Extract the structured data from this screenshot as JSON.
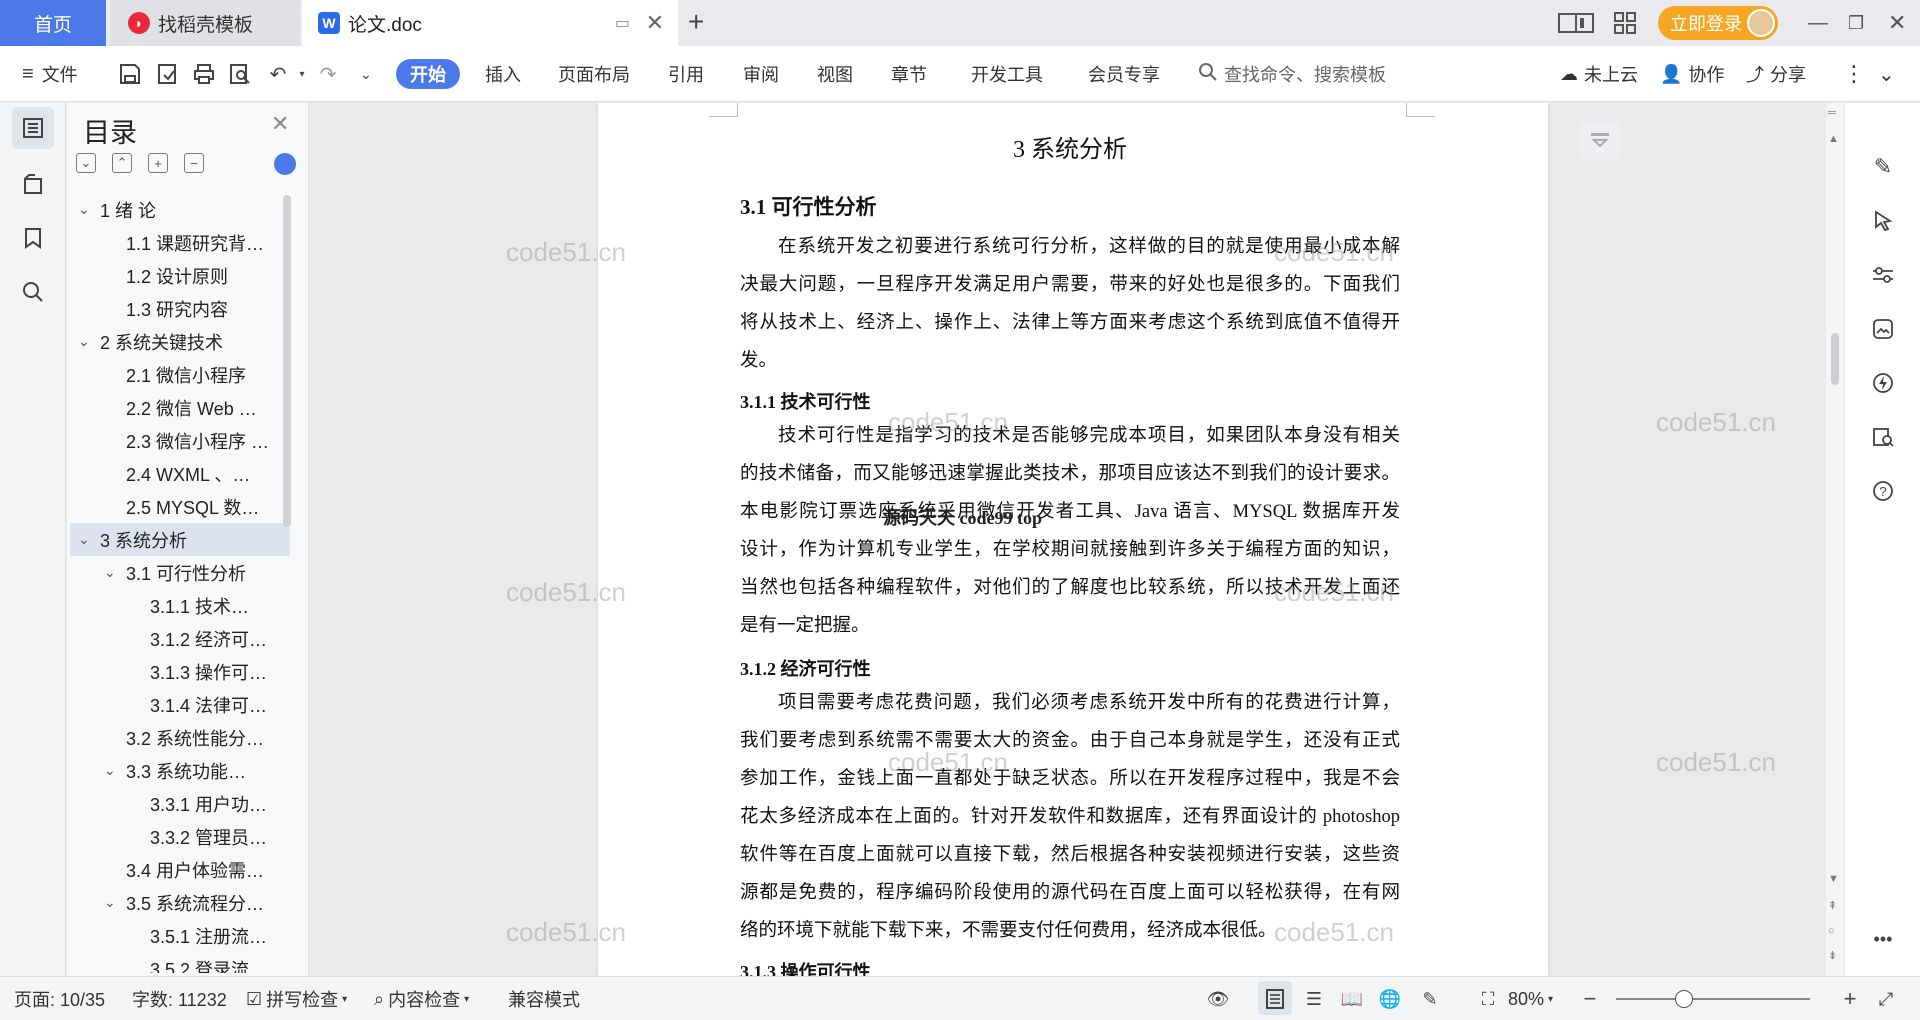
{
  "titlebar": {
    "home_tab": "首页",
    "daoke_tab": "找稻壳模板",
    "doc_tab": "论文.doc",
    "new_tab": "+",
    "login": "立即登录"
  },
  "ribbon": {
    "file": "文件",
    "start": "开始",
    "menus": [
      "插入",
      "页面布局",
      "引用",
      "审阅",
      "视图",
      "章节",
      "开发工具",
      "会员专享"
    ],
    "search_placeholder": "查找命令、搜索模板",
    "cloud": "未上云",
    "collab": "协作",
    "share": "分享"
  },
  "toc": {
    "title": "目录",
    "items": [
      {
        "label": "1  绪  论",
        "level": 1,
        "arrow": true
      },
      {
        "label": "1.1 课题研究背…",
        "level": 2
      },
      {
        "label": "1.2 设计原则",
        "level": 2
      },
      {
        "label": "1.3 研究内容",
        "level": 2
      },
      {
        "label": "2 系统关键技术",
        "level": 1,
        "arrow": true
      },
      {
        "label": "2.1 微信小程序",
        "level": 2
      },
      {
        "label": "2.2 微信 Web …",
        "level": 2
      },
      {
        "label": "2.3 微信小程序 …",
        "level": 2
      },
      {
        "label": "2.4 WXML 、…",
        "level": 2
      },
      {
        "label": "2.5 MYSQL 数…",
        "level": 2
      },
      {
        "label": "3 系统分析",
        "level": 1,
        "arrow": true,
        "selected": true
      },
      {
        "label": "3.1 可行性分析",
        "level": 2,
        "arrow": true
      },
      {
        "label": "3.1.1  技术…",
        "level": 3
      },
      {
        "label": "3.1.2 经济可…",
        "level": 3
      },
      {
        "label": "3.1.3 操作可…",
        "level": 3
      },
      {
        "label": "3.1.4 法律可…",
        "level": 3
      },
      {
        "label": "3.2 系统性能分…",
        "level": 2
      },
      {
        "label": "3.3   系统功能…",
        "level": 2,
        "arrow": true
      },
      {
        "label": "3.3.1 用户功…",
        "level": 3
      },
      {
        "label": "3.3.2 管理员…",
        "level": 3
      },
      {
        "label": "3.4 用户体验需…",
        "level": 2
      },
      {
        "label": "3.5 系统流程分…",
        "level": 2,
        "arrow": true
      },
      {
        "label": "3.5.1 注册流…",
        "level": 3
      },
      {
        "label": "3.5.2 登录流…",
        "level": 3
      }
    ]
  },
  "document": {
    "chapter_title": "3 系统分析",
    "sec_31": "3.1 可行性分析",
    "para_intro": [
      "在系统开发之初要进行系统可行分析，这样做的目的就是使用最小成本解",
      "决最大问题，一旦程序开发满足用户需要，带来的好处也是很多的。下面我们",
      "将从技术上、经济上、操作上、法律上等方面来考虑这个系统到底值不值得开",
      "发。"
    ],
    "sec_311": "3.1.1  技术可行性",
    "para_tech": [
      "技术可行性是指学习的技术是否能够完成本项目，如果团队本身没有相关",
      "的技术储备，而又能够迅速掌握此类技术，那项目应该达不到我们的设计要求。",
      "本电影院订票选座系统采用微信开发者工具、Java 语言、MYSQL 数据库开发",
      "设计，作为计算机专业学生，在学校期间就接触到许多关于编程方面的知识，",
      "当然也包括各种编程软件，对他们的了解度也比较系统，所以技术开发上面还",
      "是有一定把握。"
    ],
    "stamp": "源码天天 code99 top",
    "sec_312": "3.1.2 经济可行性",
    "para_econ": [
      "项目需要考虑花费问题，我们必须考虑系统开发中所有的花费进行计算，",
      "我们要考虑到系统需不需要太大的资金。由于自己本身就是学生，还没有正式",
      "参加工作，金钱上面一直都处于缺乏状态。所以在开发程序过程中，我是不会",
      "花太多经济成本在上面的。针对开发软件和数据库，还有界面设计的 photoshop",
      "软件等在百度上面就可以直接下载，然后根据各种安装视频进行安装，这些资",
      "源都是免费的，程序编码阶段使用的源代码在百度上面可以轻松获得，在有网",
      "络的环境下就能下载下来，不需要支付任何费用，经济成本很低。"
    ],
    "sec_313": "3.1.3 操作可行性"
  },
  "watermark": "code51.cn",
  "statusbar": {
    "page": "页面: 10/35",
    "words": "字数: 11232",
    "spell": "拼写检查",
    "content": "内容检查",
    "compat": "兼容模式",
    "zoom": "80%",
    "zoom_level": 0.35
  }
}
